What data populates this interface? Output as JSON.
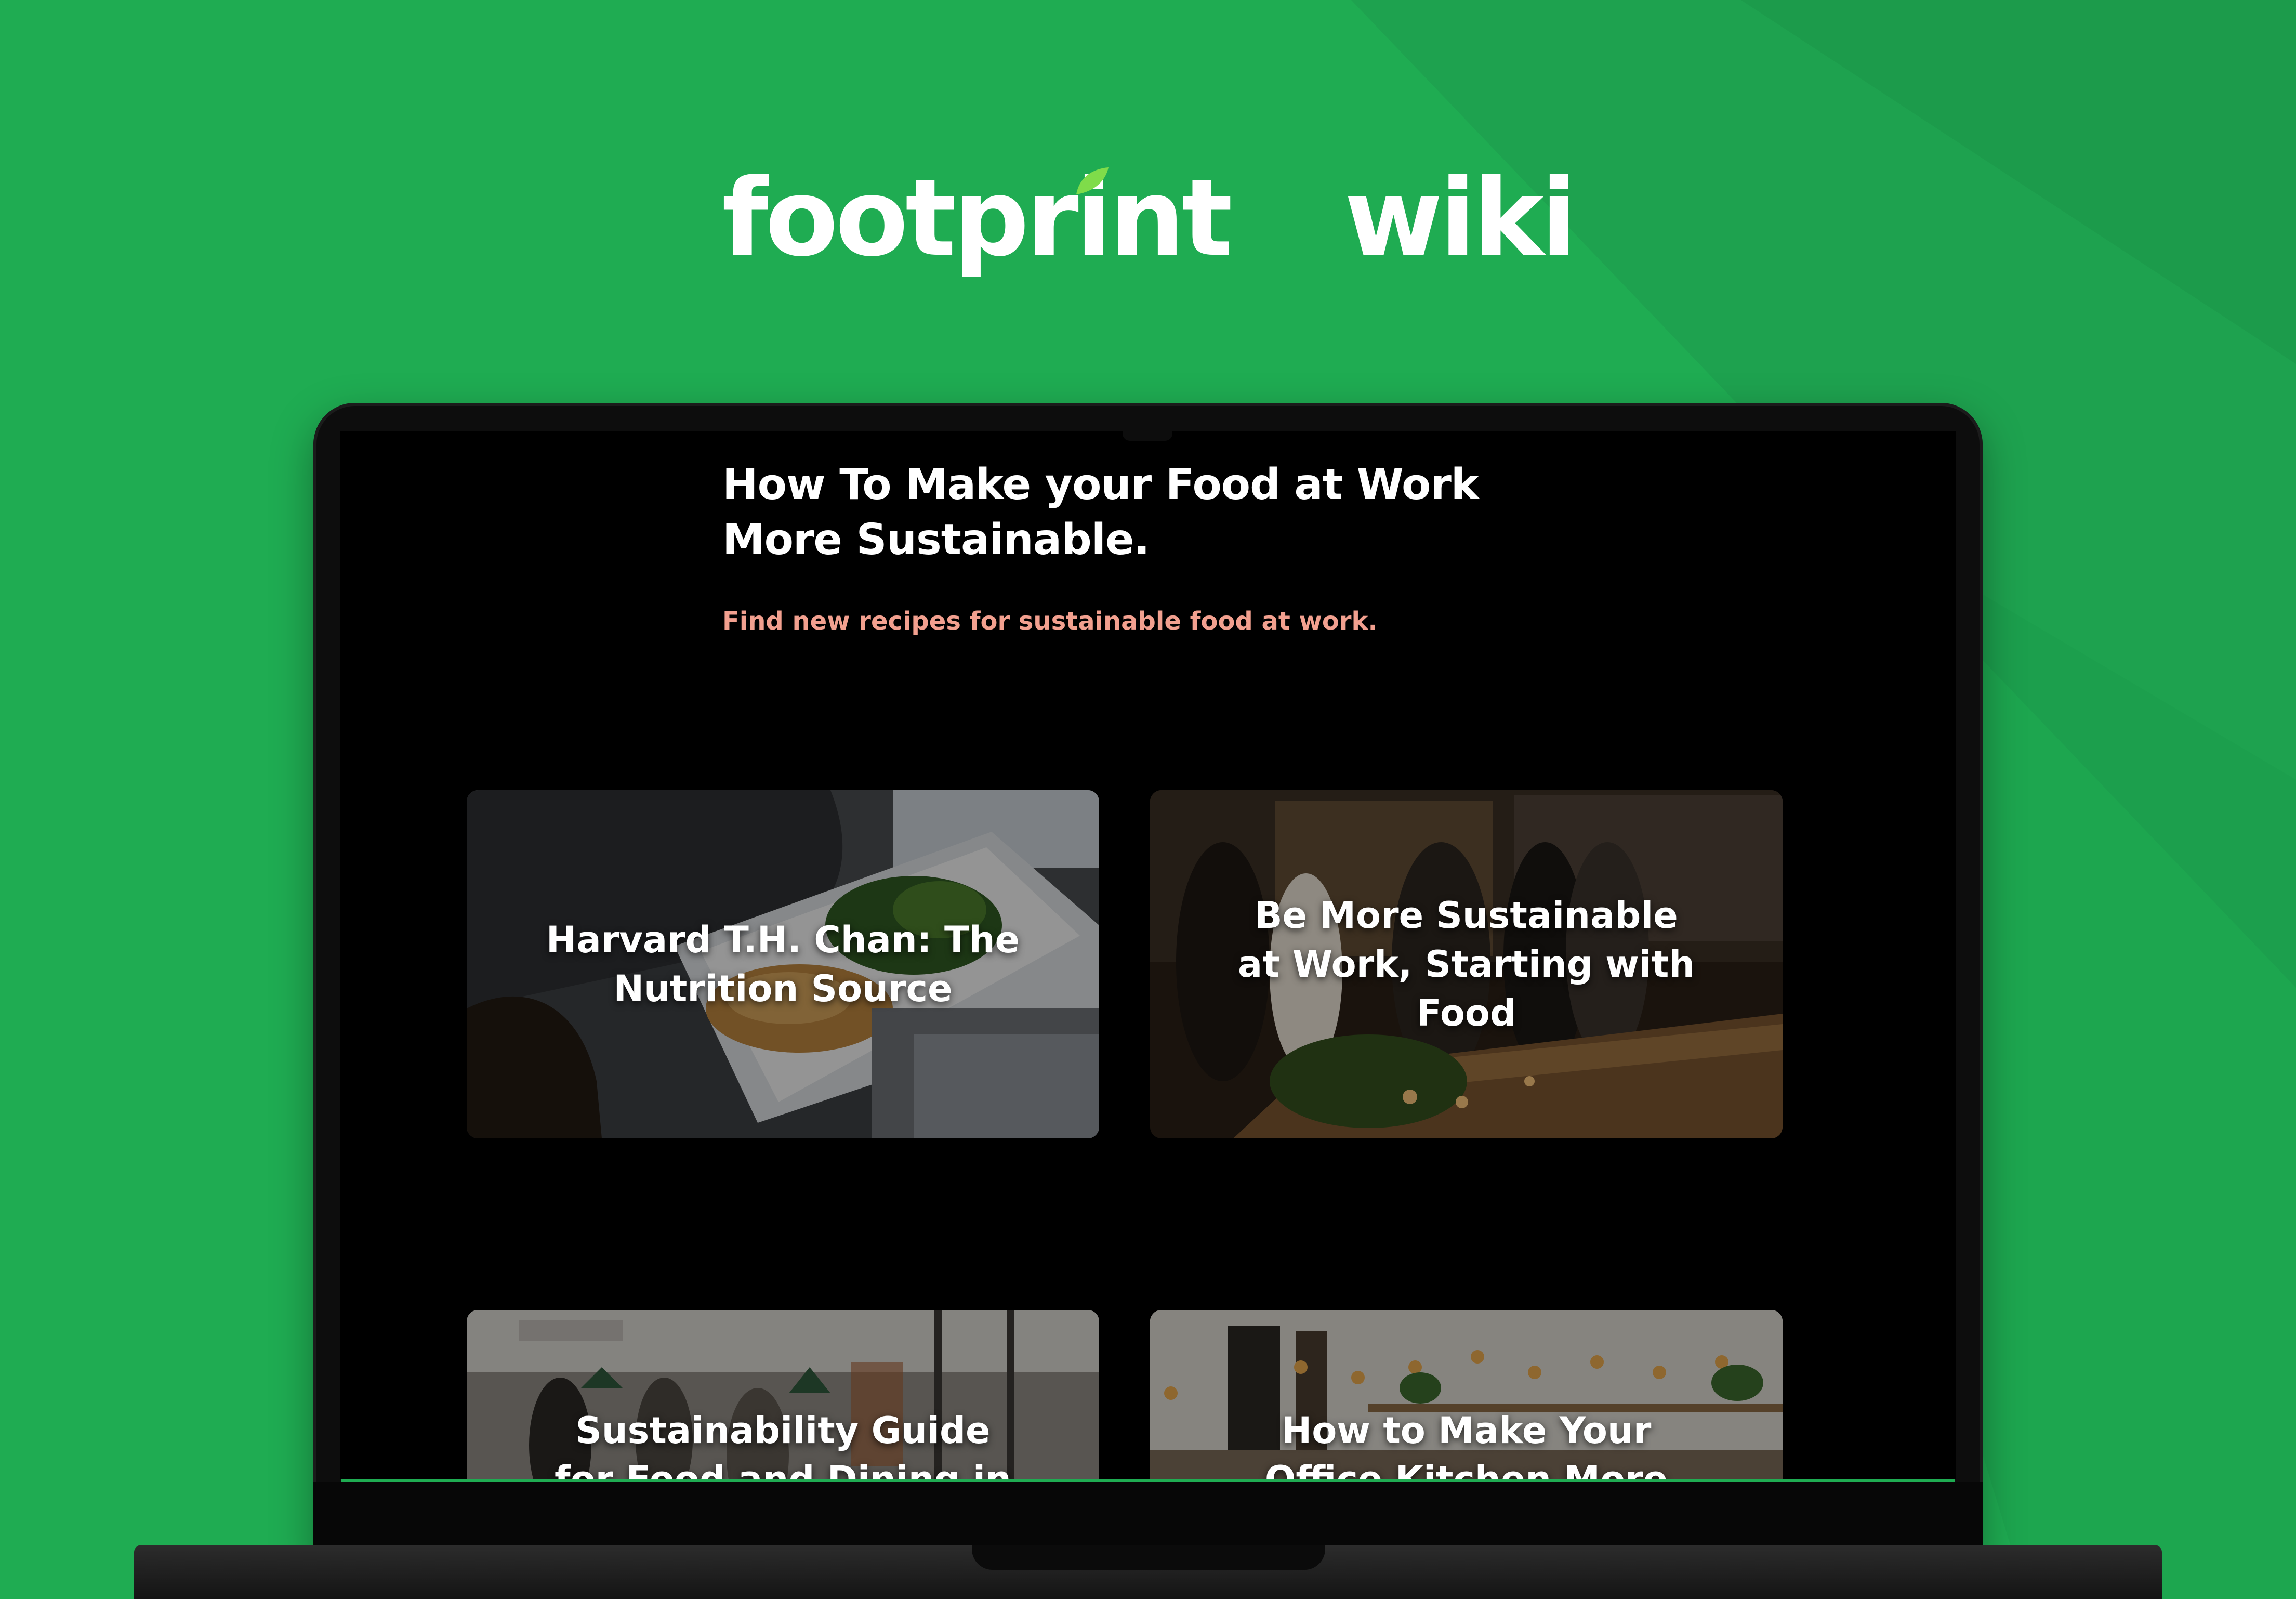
{
  "brand": {
    "logo_word_1": "footprint",
    "logo_word_2": "wiki",
    "leaf_color": "#7fdc4a"
  },
  "colors": {
    "background": "#1fac52",
    "background_facet": "#1d9b4c",
    "subtitle": "#f2a08f",
    "screen": "#000000"
  },
  "page": {
    "title": "How To Make your Food at Work More Sustainable.",
    "subtitle": "Find new recipes for sustainable food at work."
  },
  "cards": [
    {
      "title": "Harvard T.H. Chan: The Nutrition Source"
    },
    {
      "title": "Be More Sustainable at Work, Starting with Food"
    },
    {
      "title": "Sustainability Guide for Food and Dining in the"
    },
    {
      "title": "How to Make Your Office Kitchen More"
    }
  ]
}
